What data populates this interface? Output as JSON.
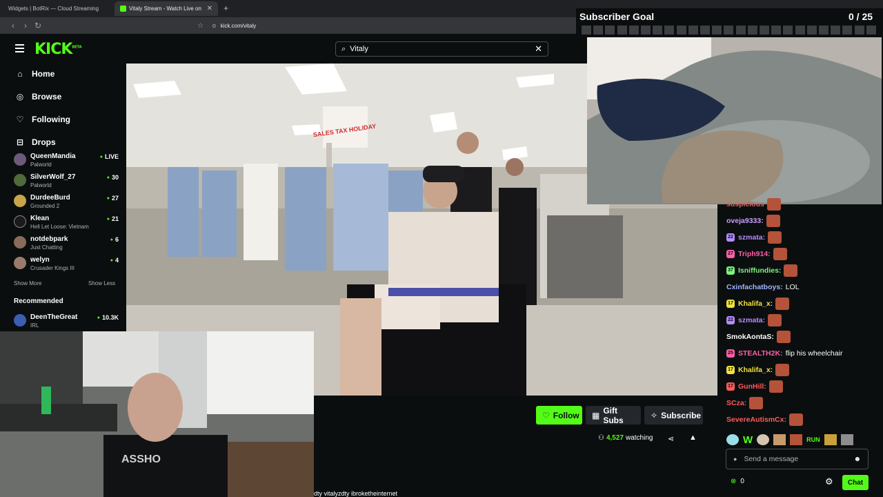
{
  "browser": {
    "tabs": [
      {
        "title": "Widgets | BotRix — Cloud Streaming"
      },
      {
        "title": "Vitaly Stream - Watch Live on"
      }
    ],
    "url": "kick.com/vitaly"
  },
  "kick": {
    "logo": "KICK",
    "logo_badge": "BETA",
    "nav": [
      {
        "label": "Home",
        "icon": "home-icon"
      },
      {
        "label": "Browse",
        "icon": "compass-icon"
      },
      {
        "label": "Following",
        "icon": "heart-icon"
      },
      {
        "label": "Drops",
        "icon": "bookmark-icon"
      }
    ],
    "following": [
      {
        "name": "QueenMandia",
        "game": "Palworld",
        "viewers": "LIVE"
      },
      {
        "name": "SilverWolf_27",
        "game": "Palworld",
        "viewers": "30"
      },
      {
        "name": "DurdeeBurd",
        "game": "Grounded 2",
        "viewers": "27"
      },
      {
        "name": "Klean",
        "game": "Hell Let Loose: Vietnam",
        "viewers": "21"
      },
      {
        "name": "notdebpark",
        "game": "Just Chatting",
        "viewers": "6"
      },
      {
        "name": "welyn",
        "game": "Crusader Kings III",
        "viewers": "4"
      }
    ],
    "show_more": "Show More",
    "show_less": "Show Less",
    "recommended_label": "Recommended",
    "recommended": [
      {
        "name": "DeenTheGreat",
        "game": "IRL",
        "viewers": "10.3K"
      }
    ],
    "search_value": "Vitaly",
    "video_sign": "SALES TAX HOLIDAY",
    "buttons": {
      "follow": "Follow",
      "gifts": "Gift Subs",
      "subscribe": "Subscribe"
    },
    "viewers_count": "4,527",
    "viewers_label": "watching",
    "socials": "dty   vitalyzdty   ibroketheinternet"
  },
  "cam_shirt": "ASSHO",
  "goal": {
    "title": "Subscriber Goal",
    "value": "0 / 25"
  },
  "chat": {
    "messages": [
      {
        "user": "suspicious",
        "color": "#e05f5f",
        "badge": "",
        "text": "",
        "emote": true
      },
      {
        "user": "oveja9333:",
        "color": "#c8a0ff",
        "badge": "",
        "text": "",
        "emote": true
      },
      {
        "user": "szmata:",
        "color": "#b48cff",
        "badge": "22",
        "text": "",
        "emote": true
      },
      {
        "user": "Triph914:",
        "color": "#ff5fa8",
        "badge": "27",
        "text": "",
        "emote": true
      },
      {
        "user": "Isniffundies:",
        "color": "#7cf57c",
        "badge": "37",
        "text": "",
        "emote": true
      },
      {
        "user": "Cxinfachatboys:",
        "color": "#a0b4ff",
        "badge": "",
        "text": "LOL",
        "emote": false
      },
      {
        "user": "Khalifa_x:",
        "color": "#f0e040",
        "badge": "17",
        "text": "",
        "emote": true
      },
      {
        "user": "szmata:",
        "color": "#b48cff",
        "badge": "22",
        "text": "",
        "emote": true
      },
      {
        "user": "SmokAontaS:",
        "color": "#ffffff",
        "badge": "",
        "text": "",
        "emote": true
      },
      {
        "user": "STEALTH2K:",
        "color": "#ff5fa8",
        "badge": "25",
        "text": "flip his wheelchair",
        "emote": false
      },
      {
        "user": "Khalifa_x:",
        "color": "#f0e040",
        "badge": "17",
        "text": "",
        "emote": true
      },
      {
        "user": "GunHill:",
        "color": "#ff5b5b",
        "badge": "17",
        "text": "",
        "emote": true
      },
      {
        "user": "SCza:",
        "color": "#ff5b5b",
        "badge": "",
        "text": "",
        "emote": true
      },
      {
        "user": "SevereAutismCx:",
        "color": "#ff5b5b",
        "badge": "",
        "text": "",
        "emote": true
      }
    ],
    "emote_bar_text": "W",
    "emote_bar_run": "RUN",
    "placeholder": "Send a message",
    "points": "0",
    "chat_button": "Chat"
  }
}
